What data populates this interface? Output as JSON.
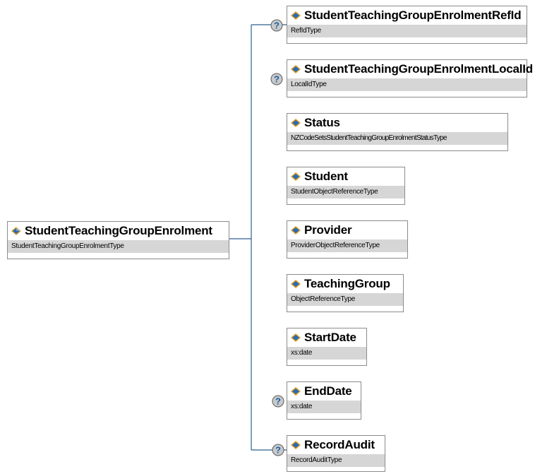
{
  "root": {
    "name": "StudentTeachingGroupEnrolment",
    "type": "StudentTeachingGroupEnrolmentType"
  },
  "children": [
    {
      "name": "StudentTeachingGroupEnrolmentRefId",
      "type": "RefIdType",
      "optional": true
    },
    {
      "name": "StudentTeachingGroupEnrolmentLocalId",
      "type": "LocalIdType",
      "optional": true
    },
    {
      "name": "Status",
      "type": "NZCodeSetsStudentTeachingGroupEnrolmentStatusType",
      "optional": false
    },
    {
      "name": "Student",
      "type": "StudentObjectReferenceType",
      "optional": false
    },
    {
      "name": "Provider",
      "type": "ProviderObjectReferenceType",
      "optional": false
    },
    {
      "name": "TeachingGroup",
      "type": "ObjectReferenceType",
      "optional": false
    },
    {
      "name": "StartDate",
      "type": "xs:date",
      "optional": false
    },
    {
      "name": "EndDate",
      "type": "xs:date",
      "optional": true
    },
    {
      "name": "RecordAudit",
      "type": "RecordAuditType",
      "optional": true
    }
  ],
  "optional_marker": "?",
  "colors": {
    "connector": "#2f5f8f",
    "type_band": "#d6d6d6",
    "icon_blue": "#2a6ab8",
    "icon_gold": "#e0a020",
    "optional_fill": "#c9c9c9"
  }
}
